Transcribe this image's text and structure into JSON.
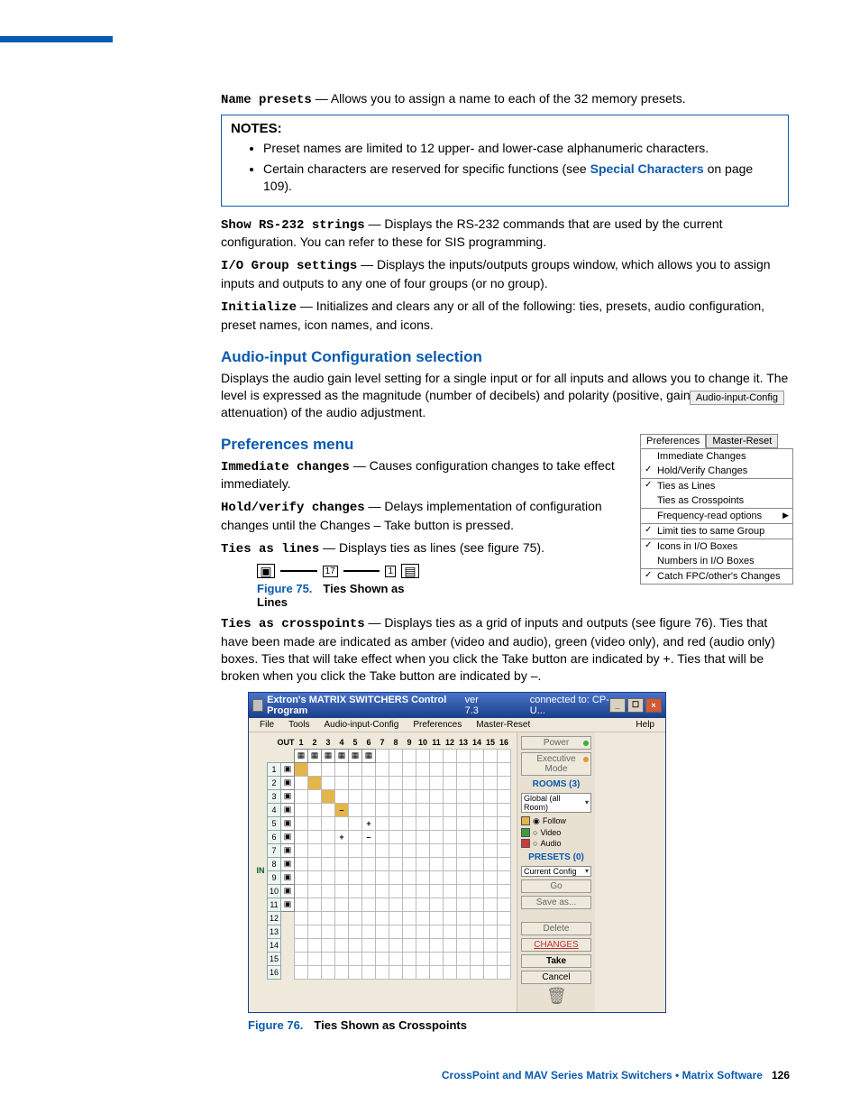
{
  "top": {
    "name_presets_label": "Name presets",
    "name_presets_desc": " — Allows you to assign a name to each of the 32 memory presets.",
    "notes_title": "NOTES:",
    "note1": "Preset names are limited to 12 upper- and lower-case alphanumeric characters.",
    "note2_a": "Certain characters are reserved for specific functions (see ",
    "note2_link": "Special Characters",
    "note2_b": " on page 109).",
    "show_rs232_label": "Show RS-232 strings",
    "show_rs232_desc": " — Displays the RS-232 commands that are used by the current configuration. You can refer to these for SIS programming.",
    "io_group_label": "I/O Group settings",
    "io_group_desc": " — Displays the inputs/outputs groups window, which allows you to assign inputs and outputs to any one of four groups (or no group).",
    "initialize_label": "Initialize",
    "initialize_desc": " — Initializes and clears any or all of the following: ties, presets, audio configuration, preset names, icon names, and icons."
  },
  "tag_text": "Audio-input-Config",
  "audio": {
    "heading": "Audio-input Configuration selection",
    "body": "Displays the audio gain level setting for a single input or for all inputs and allows you to change it. The level is expressed as the magnitude (number of decibels) and polarity (positive, gain or negative, attenuation) of the audio adjustment."
  },
  "prefs": {
    "heading": "Preferences menu",
    "imm_label": "Immediate changes",
    "imm_desc": " — Causes configuration changes to take effect immediately.",
    "hold_label": "Hold/verify changes",
    "hold_desc": " — Delays implementation of configuration changes until the Changes – Take button is pressed.",
    "ties_lines_label": "Ties as lines",
    "ties_lines_desc": " — Displays ties as lines (see figure 75).",
    "fig75_17": "17",
    "fig75_1": "1",
    "fig75_caption_num": "Figure 75.",
    "fig75_caption_text": "Ties Shown as Lines",
    "ties_cp_label": "Ties as crosspoints",
    "ties_cp_desc": " — Displays ties as a grid of inputs and outputs (see figure 76). Ties that have been made are indicated as amber (video and audio), green (video only), and red (audio only) boxes. Ties that will take effect when you click the Take button are indicated by +. Ties that will be broken when you click the Take button are indicated by –.",
    "menu": {
      "tab1": "Preferences",
      "tab2": "Master-Reset",
      "items": [
        {
          "t": "Immediate Changes"
        },
        {
          "t": "Hold/Verify Changes",
          "c": true
        },
        {
          "sep": true
        },
        {
          "t": "Ties as Lines",
          "c": true
        },
        {
          "t": "Ties as Crosspoints"
        },
        {
          "sep": true
        },
        {
          "t": "Frequency-read options",
          "arrow": true
        },
        {
          "sep": true
        },
        {
          "t": "Limit ties to same Group",
          "c": true
        },
        {
          "sep": true
        },
        {
          "t": "Icons in I/O Boxes",
          "c": true
        },
        {
          "t": "Numbers in I/O Boxes"
        },
        {
          "sep": true
        },
        {
          "t": "Catch FPC/other's Changes",
          "c": true
        }
      ]
    }
  },
  "fig76": {
    "title": "Extron's MATRIX SWITCHERS Control Program",
    "ver": "ver 7.3",
    "conn": "connected to:  CP-U...",
    "menus": [
      "File",
      "Tools",
      "Audio-input-Config",
      "Preferences",
      "Master-Reset"
    ],
    "help": "Help",
    "out_label": "OUT",
    "in_label": "IN",
    "cols": 16,
    "rows": 16,
    "top_icons_cols": 6,
    "row_icon_rows": 11,
    "amber_cells": [
      [
        1,
        1
      ],
      [
        2,
        2
      ],
      [
        3,
        3
      ],
      [
        4,
        4
      ]
    ],
    "minus_cells": [
      [
        4,
        4
      ],
      [
        6,
        6
      ]
    ],
    "plus_cells": [
      [
        5,
        6
      ],
      [
        6,
        4
      ]
    ],
    "sidebar": {
      "power": "Power",
      "exec": "Executive Mode",
      "rooms": "ROOMS (3)",
      "room_sel": "Global (all Room)",
      "follow": "Follow",
      "video": "Video",
      "audio": "Audio",
      "presets": "PRESETS (0)",
      "preset_sel": "Current Config",
      "go": "Go",
      "save": "Save as...",
      "delete": "Delete",
      "changes": "CHANGES",
      "take": "Take",
      "cancel": "Cancel"
    },
    "caption_num": "Figure 76.",
    "caption_text": "Ties Shown as Crosspoints"
  },
  "footer": {
    "product": "CrossPoint and MAV Series Matrix Switchers • Matrix Software",
    "page": "126"
  }
}
